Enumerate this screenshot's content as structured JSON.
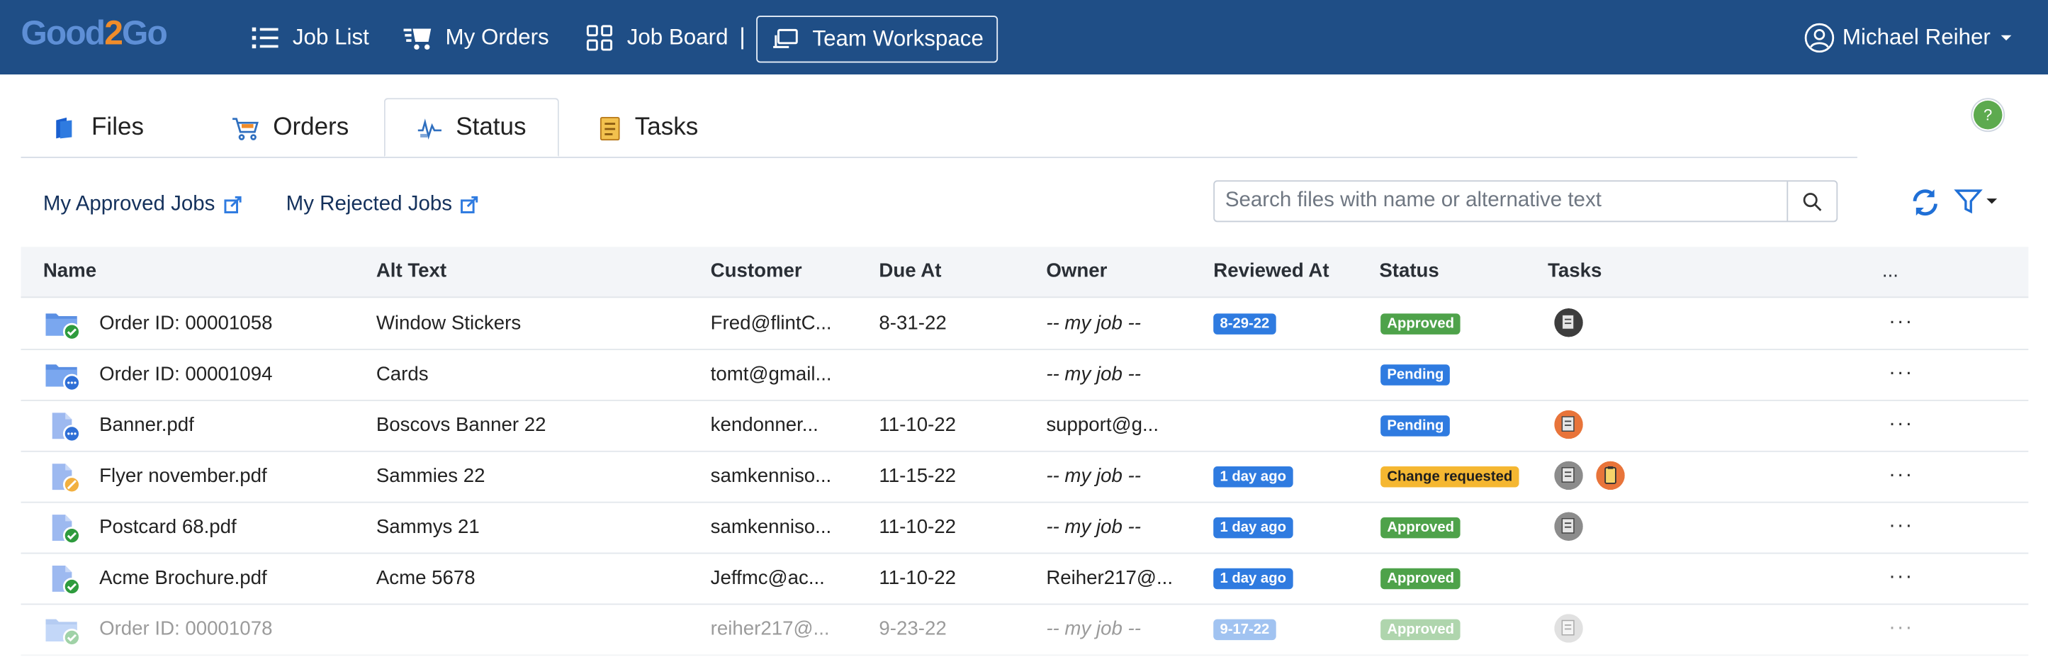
{
  "app": {
    "logo_part1": "Good",
    "logo_part2": "2",
    "logo_part3": "Go",
    "nav": [
      {
        "label": "Job List",
        "icon": "list-icon"
      },
      {
        "label": "My Orders",
        "icon": "orders-icon"
      },
      {
        "label": "Job Board",
        "icon": "grid-icon"
      },
      {
        "label": "Team Workspace",
        "icon": "workspace-icon"
      }
    ],
    "separator": "|",
    "user": "Michael Reiher"
  },
  "tabs": [
    {
      "label": "Files",
      "icon": "files-icon"
    },
    {
      "label": "Orders",
      "icon": "cart-icon"
    },
    {
      "label": "Status",
      "icon": "status-icon",
      "active": true
    },
    {
      "label": "Tasks",
      "icon": "tasks-icon"
    }
  ],
  "help": "?",
  "links": {
    "approved": "My Approved Jobs",
    "rejected": "My Rejected Jobs"
  },
  "search": {
    "placeholder": "Search files with name or alternative text",
    "value": ""
  },
  "table": {
    "headers": [
      "Name",
      "Alt Text",
      "Customer",
      "Due At",
      "Owner",
      "Reviewed At",
      "Status",
      "Tasks",
      "..."
    ],
    "rows": [
      {
        "name": "Order ID: 00001058",
        "alt": "Window Stickers",
        "customer": "Fred@flintC...",
        "due": "8-31-22",
        "owner": "-- my job --",
        "reviewed": "8-29-22",
        "status": "Approved",
        "icon": "folder-approved-icon",
        "tasks": [
          "dark"
        ]
      },
      {
        "name": "Order ID: 00001094",
        "alt": "Cards",
        "customer": "tomt@gmail...",
        "due": "",
        "owner": "-- my job --",
        "reviewed": "",
        "status": "Pending",
        "icon": "folder-pending-icon",
        "tasks": []
      },
      {
        "name": "Banner.pdf",
        "alt": "Boscovs Banner 22",
        "customer": "kendonner...",
        "due": "11-10-22",
        "owner": "support@g...",
        "reviewed": "",
        "status": "Pending",
        "icon": "file-pending-icon",
        "tasks": [
          "orange"
        ]
      },
      {
        "name": "Flyer november.pdf",
        "alt": "Sammies 22",
        "customer": "samkenniso...",
        "due": "11-15-22",
        "owner": "-- my job --",
        "reviewed": "1 day ago",
        "status": "Change requested",
        "icon": "file-change-icon",
        "tasks": [
          "gray",
          "orange-clip"
        ]
      },
      {
        "name": "Postcard 68.pdf",
        "alt": "Sammys 21",
        "customer": "samkenniso...",
        "due": "11-10-22",
        "owner": "-- my job --",
        "reviewed": "1 day ago",
        "status": "Approved",
        "icon": "file-approved-icon",
        "tasks": [
          "gray"
        ]
      },
      {
        "name": "Acme Brochure.pdf",
        "alt": "Acme 5678",
        "customer": "Jeffmc@ac...",
        "due": "11-10-22",
        "owner": "Reiher217@...",
        "reviewed": "1 day ago",
        "status": "Approved",
        "icon": "file-approved-icon",
        "tasks": []
      },
      {
        "name": "Order ID: 00001078",
        "alt": "",
        "customer": "reiher217@...",
        "due": "9-23-22",
        "owner": "-- my job --",
        "reviewed": "9-17-22",
        "status": "Approved",
        "icon": "folder-approved-icon",
        "tasks": [
          "light"
        ]
      }
    ],
    "row_menu": "···"
  },
  "colors": {
    "nav_bg": "#1f4e86",
    "approved": "#4ea24a",
    "pending": "#2f7be0",
    "change": "#f5b731"
  }
}
